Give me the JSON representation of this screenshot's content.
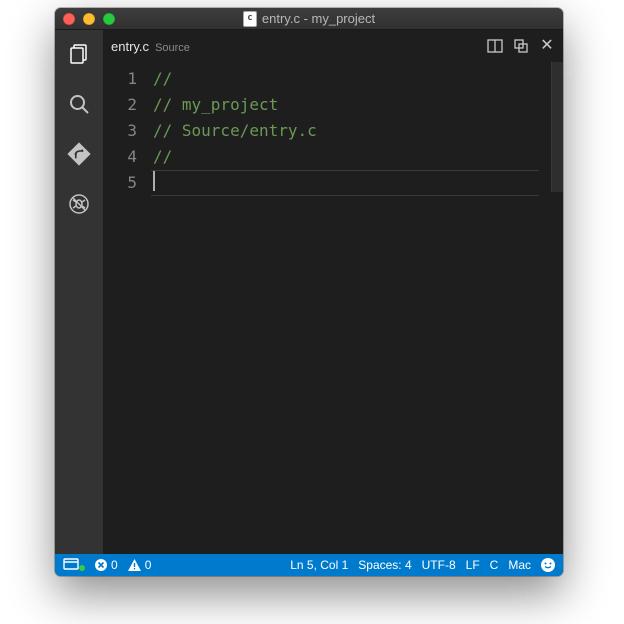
{
  "titlebar": {
    "file_badge": "c",
    "title": "entry.c - my_project"
  },
  "activity": {
    "items": [
      "explorer",
      "search",
      "git",
      "debug"
    ]
  },
  "tab": {
    "filename": "entry.c",
    "directory": "Source"
  },
  "editor": {
    "line_numbers": [
      "1",
      "2",
      "3",
      "4",
      "5"
    ],
    "lines": [
      "//",
      "// my_project",
      "// Source/entry.c",
      "//",
      ""
    ],
    "current_line_index": 4
  },
  "status": {
    "errors": "0",
    "warnings": "0",
    "ln_col": "Ln 5, Col 1",
    "spaces": "Spaces: 4",
    "encoding": "UTF-8",
    "eol": "LF",
    "language": "C",
    "os": "Mac"
  }
}
